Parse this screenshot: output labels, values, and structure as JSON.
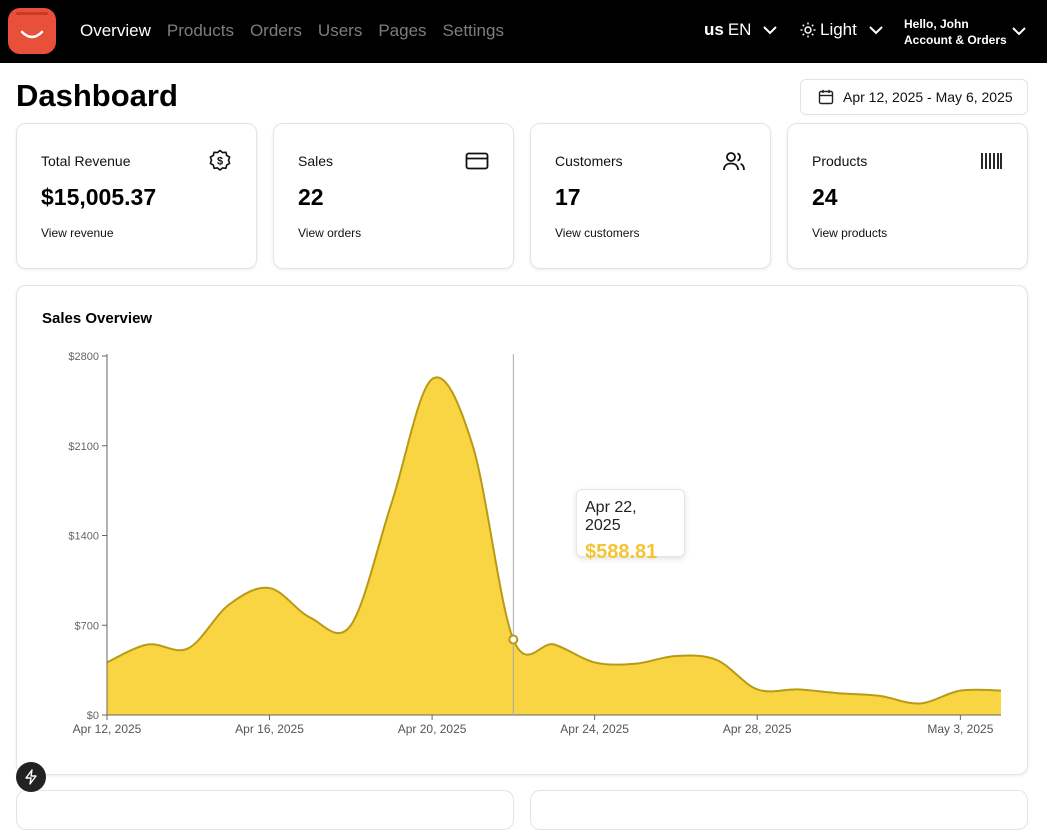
{
  "nav": {
    "items": [
      {
        "label": "Overview",
        "active": true
      },
      {
        "label": "Products",
        "active": false
      },
      {
        "label": "Orders",
        "active": false
      },
      {
        "label": "Users",
        "active": false
      },
      {
        "label": "Pages",
        "active": false
      },
      {
        "label": "Settings",
        "active": false
      }
    ]
  },
  "header": {
    "language": {
      "flag": "us",
      "code": "EN"
    },
    "theme": {
      "label": "Light"
    },
    "account": {
      "greeting": "Hello, John",
      "label": "Account & Orders"
    }
  },
  "page": {
    "title": "Dashboard",
    "date_range": "Apr 12, 2025 - May 6, 2025"
  },
  "stats": [
    {
      "label": "Total Revenue",
      "value": "$15,005.37",
      "link": "View revenue",
      "icon": "dollar-badge-icon"
    },
    {
      "label": "Sales",
      "value": "22",
      "link": "View orders",
      "icon": "credit-card-icon"
    },
    {
      "label": "Customers",
      "value": "17",
      "link": "View customers",
      "icon": "users-icon"
    },
    {
      "label": "Products",
      "value": "24",
      "link": "View products",
      "icon": "barcode-icon"
    }
  ],
  "sales_overview": {
    "title": "Sales Overview",
    "tooltip": {
      "date": "Apr 22, 2025",
      "value": "$588.81"
    }
  },
  "colors": {
    "accent": "#f9d443",
    "accent_stroke": "#b89b14",
    "logo": "#e8503a"
  },
  "chart_data": {
    "type": "area",
    "x": [
      "Apr 12, 2025",
      "Apr 13, 2025",
      "Apr 14, 2025",
      "Apr 15, 2025",
      "Apr 16, 2025",
      "Apr 17, 2025",
      "Apr 18, 2025",
      "Apr 19, 2025",
      "Apr 20, 2025",
      "Apr 21, 2025",
      "Apr 22, 2025",
      "Apr 23, 2025",
      "Apr 24, 2025",
      "Apr 25, 2025",
      "Apr 26, 2025",
      "Apr 27, 2025",
      "Apr 28, 2025",
      "Apr 29, 2025",
      "Apr 30, 2025",
      "May 1, 2025",
      "May 2, 2025",
      "May 3, 2025",
      "May 4, 2025"
    ],
    "values": [
      410,
      550,
      520,
      860,
      990,
      760,
      700,
      1650,
      2620,
      2100,
      588.81,
      550,
      410,
      400,
      460,
      430,
      200,
      200,
      170,
      150,
      90,
      190,
      190
    ],
    "x_ticks": [
      "Apr 12, 2025",
      "Apr 16, 2025",
      "Apr 20, 2025",
      "Apr 24, 2025",
      "Apr 28, 2025",
      "May 3, 2025"
    ],
    "y_ticks": [
      "$0",
      "$700",
      "$1400",
      "$2100",
      "$2800"
    ],
    "ylim": [
      0,
      2800
    ],
    "grid": false
  }
}
